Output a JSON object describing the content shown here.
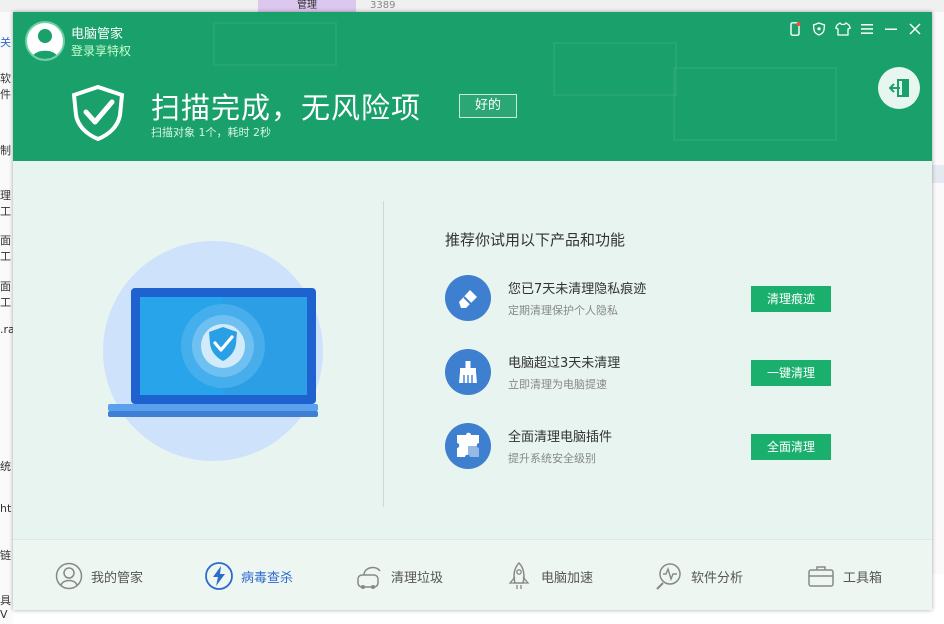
{
  "background": {
    "top_tab": "管理",
    "top_number": "3389",
    "left_fragments": [
      "关",
      "软件",
      "制",
      "理工",
      "面工",
      "面工",
      ".ra",
      "统",
      "ht",
      "链",
      "具V"
    ]
  },
  "header": {
    "app_title": "电脑管家",
    "login_link": "登录享特权",
    "result_title": "扫描完成，无风险项",
    "ok_button": "好的",
    "scan_info": "扫描对象 1个，耗时 2秒"
  },
  "recommend": {
    "title": "推荐你试用以下产品和功能",
    "items": [
      {
        "title": "您已7天未清理隐私痕迹",
        "subtitle": "定期清理保护个人隐私",
        "button": "清理痕迹",
        "icon": "eraser-icon"
      },
      {
        "title": "电脑超过3天未清理",
        "subtitle": "立即清理为电脑提速",
        "button": "一键清理",
        "icon": "broom-icon"
      },
      {
        "title": "全面清理电脑插件",
        "subtitle": "提升系统安全级别",
        "button": "全面清理",
        "icon": "puzzle-icon"
      }
    ]
  },
  "nav": {
    "items": [
      {
        "label": "我的管家",
        "icon": "avatar-icon"
      },
      {
        "label": "病毒查杀",
        "icon": "lightning-shield-icon"
      },
      {
        "label": "清理垃圾",
        "icon": "vacuum-icon"
      },
      {
        "label": "电脑加速",
        "icon": "rocket-icon"
      },
      {
        "label": "软件分析",
        "icon": "magnifier-pulse-icon"
      },
      {
        "label": "工具箱",
        "icon": "toolbox-icon"
      }
    ]
  },
  "colors": {
    "header_green": "#1aa06a",
    "button_green": "#1aaf6d",
    "icon_blue": "#3f7fcf",
    "active_nav": "#2d6bd0"
  }
}
